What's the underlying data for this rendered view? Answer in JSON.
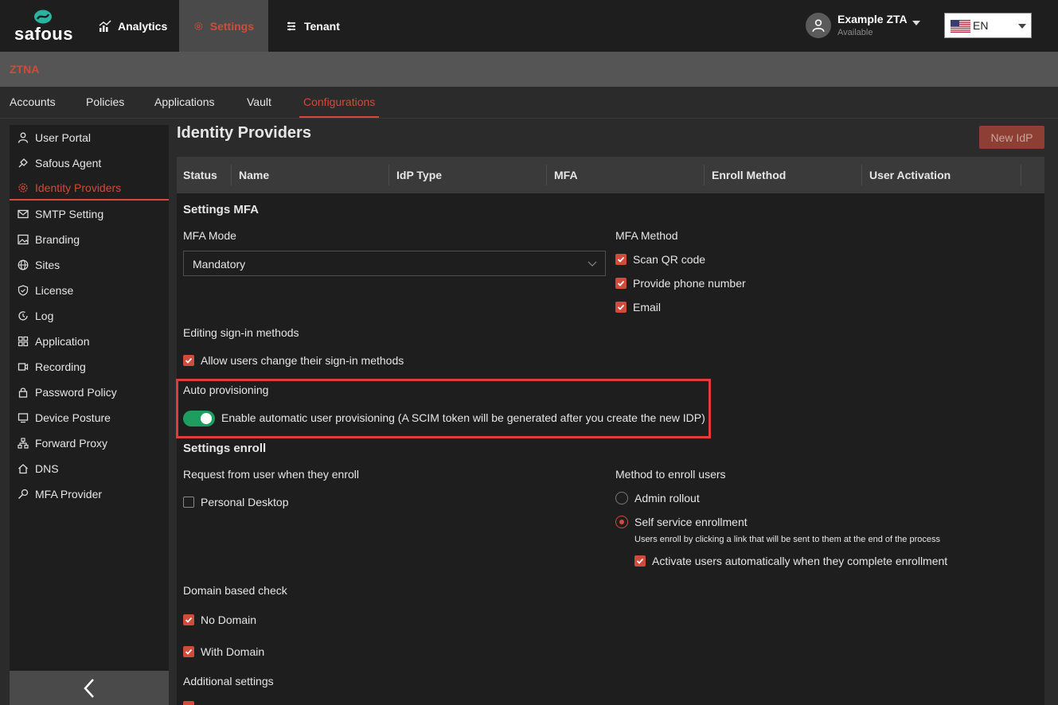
{
  "brand": {
    "name": "safous"
  },
  "topnav": [
    {
      "label": "Analytics",
      "icon": "chart-icon"
    },
    {
      "label": "Settings",
      "icon": "gear-icon"
    },
    {
      "label": "Tenant",
      "icon": "tenant-icon"
    }
  ],
  "user": {
    "name": "Example ZTA",
    "status": "Available"
  },
  "language": {
    "selected": "EN"
  },
  "section_label": "ZTNA",
  "subnav": [
    "Accounts",
    "Policies",
    "Applications",
    "Vault",
    "Configurations"
  ],
  "sidebar": [
    {
      "label": "User Portal",
      "icon": "user-icon"
    },
    {
      "label": "Safous Agent",
      "icon": "agent-icon"
    },
    {
      "label": "Identity Providers",
      "icon": "gear-icon"
    },
    {
      "label": "SMTP Setting",
      "icon": "mail-icon"
    },
    {
      "label": "Branding",
      "icon": "image-icon"
    },
    {
      "label": "Sites",
      "icon": "globe-icon"
    },
    {
      "label": "License",
      "icon": "shield-icon"
    },
    {
      "label": "Log",
      "icon": "log-icon"
    },
    {
      "label": "Application",
      "icon": "grid-icon"
    },
    {
      "label": "Recording",
      "icon": "recording-icon"
    },
    {
      "label": "Password Policy",
      "icon": "lock-icon"
    },
    {
      "label": "Device Posture",
      "icon": "monitor-icon"
    },
    {
      "label": "Forward Proxy",
      "icon": "network-icon"
    },
    {
      "label": "DNS",
      "icon": "home-icon"
    },
    {
      "label": "MFA Provider",
      "icon": "key-icon"
    }
  ],
  "page": {
    "title": "Identity Providers",
    "new_button": "New IdP"
  },
  "table": {
    "columns": [
      "Status",
      "Name",
      "IdP Type",
      "MFA",
      "Enroll Method",
      "User Activation"
    ]
  },
  "settings_mfa": {
    "heading": "Settings MFA",
    "mode_label": "MFA Mode",
    "mode_value": "Mandatory",
    "method_label": "MFA Method",
    "methods": [
      {
        "label": "Scan QR code",
        "checked": true
      },
      {
        "label": "Provide phone number",
        "checked": true
      },
      {
        "label": "Email",
        "checked": true
      }
    ],
    "editing_label": "Editing sign-in methods",
    "editing_option": "Allow users change their sign-in methods",
    "auto_label": "Auto provisioning",
    "auto_option": "Enable automatic user provisioning (A SCIM token will be generated after you create the new IDP)",
    "auto_enabled": true
  },
  "settings_enroll": {
    "heading": "Settings enroll",
    "request_label": "Request from user when they enroll",
    "request_option": "Personal Desktop",
    "method_label": "Method to enroll users",
    "method_admin": "Admin rollout",
    "method_self": "Self service enrollment",
    "self_hint": "Users enroll by clicking a link that will be sent to them at the end of the process",
    "activate_option": "Activate users automatically when they complete enrollment",
    "domain_label": "Domain based check",
    "domain_none": "No Domain",
    "domain_with": "With Domain",
    "additional_label": "Additional settings"
  },
  "colors": {
    "accent": "#d14b3a",
    "toggle_on": "#1e9e5e",
    "highlight": "#e23b3b"
  }
}
